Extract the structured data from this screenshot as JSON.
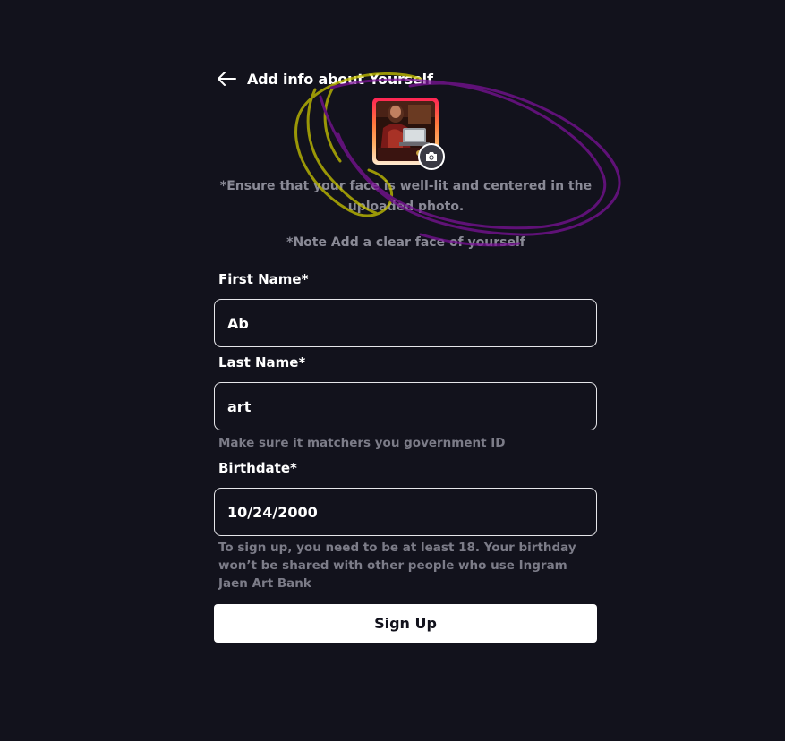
{
  "header": {
    "title": "Add info about Yourself"
  },
  "hints": {
    "face_lit": "*Ensure that your face is well-lit and centered in the uploaded photo.",
    "clear_face": "*Note Add a clear face of yourself"
  },
  "form": {
    "first_name": {
      "label": "First Name*",
      "value": "Ab"
    },
    "last_name": {
      "label": "Last Name*",
      "value": "art",
      "help": "Make sure it matchers you government ID"
    },
    "birthdate": {
      "label": "Birthdate*",
      "value": "10/24/2000",
      "help": "To sign up, you need to be at least 18. Your birthday won’t be shared with other people who use Ingram Jaen Art Bank"
    },
    "submit_label": "Sign Up"
  },
  "icons": {
    "back": "arrow-left-icon",
    "camera": "camera-icon"
  },
  "colors": {
    "background": "#12121c",
    "text": "#ffffff",
    "muted": "#8a8a96",
    "scribble_yellow": "#d8d400",
    "scribble_purple": "#8a1aa0"
  }
}
